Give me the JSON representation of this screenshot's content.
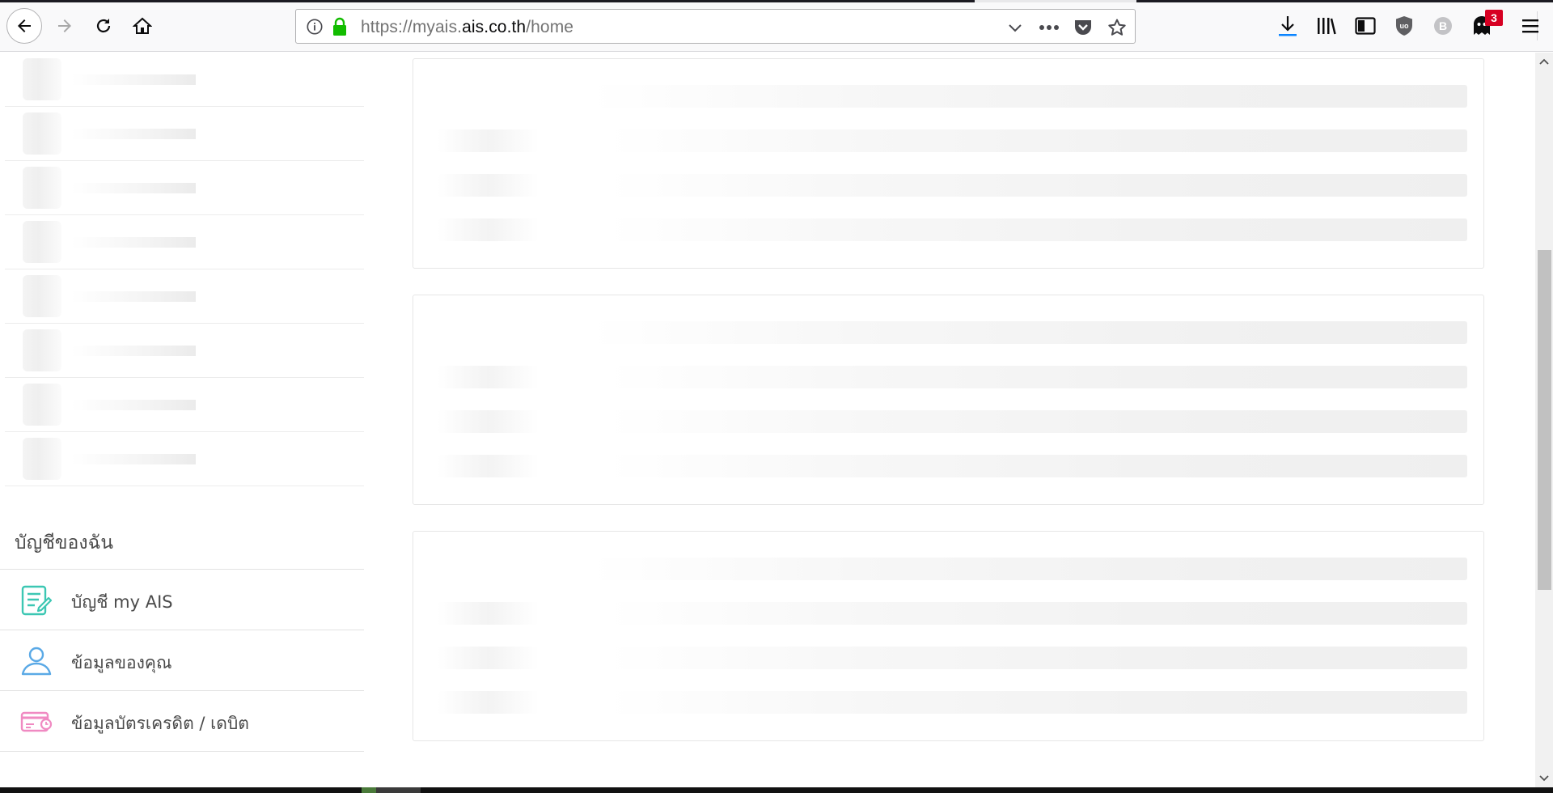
{
  "browser": {
    "url_prefix": "https://myais.",
    "url_domain": "ais.co.th",
    "url_path": "/home",
    "notification_count": "3",
    "extension_b_label": "B",
    "ublock_label": "uo"
  },
  "sidebar": {
    "section_title": "บัญชีของฉัน",
    "menu_items": [
      {
        "label": "บัญชี my AIS",
        "icon": "account-edit-icon",
        "color": "#3cc7b3"
      },
      {
        "label": "ข้อมูลของคุณ",
        "icon": "user-profile-icon",
        "color": "#5aa9e6"
      },
      {
        "label": "ข้อมูลบัตรเครดิต / เดบิต",
        "icon": "credit-card-icon",
        "color": "#f08ac2"
      }
    ]
  },
  "colors": {
    "secure_lock": "#12bc00",
    "badge": "#d70022"
  }
}
